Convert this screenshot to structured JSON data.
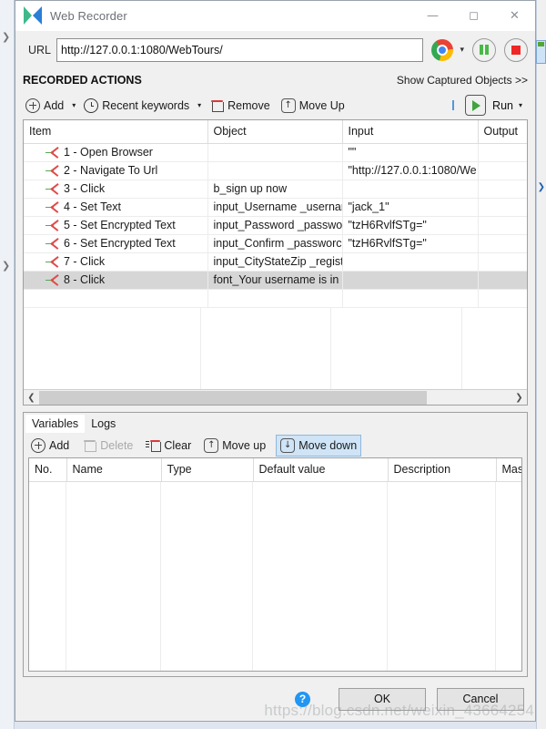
{
  "window": {
    "title": "Web Recorder",
    "logo_icon": "katalon-k-logo",
    "minimize_icon": "minimize-icon",
    "maximize_icon": "maximize-icon",
    "close_icon": "close-icon"
  },
  "url_bar": {
    "label": "URL",
    "value": "http://127.0.0.1:1080/WebTours/",
    "placeholder": "",
    "browser_icon": "chrome-icon",
    "browser_caret": "▾",
    "pause_icon": "pause-icon",
    "stop_icon": "stop-icon"
  },
  "section": {
    "title": "RECORDED ACTIONS",
    "show_captured": "Show Captured Objects >>"
  },
  "action_toolbar": {
    "add": "Add",
    "add_caret": "▾",
    "recent_keywords": "Recent keywords",
    "recent_caret": "▾",
    "remove": "Remove",
    "move_up": "Move Up",
    "move_up_glyph": "↑",
    "run": "Run",
    "run_caret": "▾"
  },
  "actions_table": {
    "columns": [
      "Item",
      "Object",
      "Input",
      "Output"
    ],
    "rows": [
      {
        "item": "1 - Open Browser",
        "object": "",
        "input": "\"\"",
        "output": ""
      },
      {
        "item": "2 - Navigate To Url",
        "object": "",
        "input": "\"http://127.0.0.1:1080/We",
        "output": ""
      },
      {
        "item": "3 - Click",
        "object": "b_sign up now",
        "input": "",
        "output": ""
      },
      {
        "item": "4 - Set Text",
        "object": "input_Username _usernar",
        "input": "\"jack_1\"",
        "output": ""
      },
      {
        "item": "5 - Set Encrypted Text",
        "object": "input_Password _passwo",
        "input": "\"tzH6RvlfSTg=\"",
        "output": ""
      },
      {
        "item": "6 - Set Encrypted Text",
        "object": "input_Confirm _passworc",
        "input": "\"tzH6RvlfSTg=\"",
        "output": ""
      },
      {
        "item": "7 - Click",
        "object": "input_CityStateZip _regist",
        "input": "",
        "output": ""
      },
      {
        "item": "8 - Click",
        "object": "font_Your username is in",
        "input": "",
        "output": "",
        "selected": true
      }
    ],
    "scroll_left_glyph": "❮",
    "scroll_right_glyph": "❯"
  },
  "variables_panel": {
    "tabs": [
      {
        "label": "Variables",
        "active": true
      },
      {
        "label": "Logs",
        "active": false
      }
    ],
    "toolbar": {
      "add": "Add",
      "delete": "Delete",
      "clear": "Clear",
      "move_up": "Move up",
      "move_up_glyph": "↑",
      "move_down": "Move down",
      "move_down_glyph": "↓"
    },
    "columns": [
      "No.",
      "Name",
      "Type",
      "Default value",
      "Description",
      "Mas..."
    ],
    "rows": []
  },
  "footer": {
    "help_glyph": "?",
    "ok": "OK",
    "cancel": "Cancel"
  },
  "watermark": "https://blog.csdn.net/weixin_43664254",
  "background": {
    "chevron_glyph": "❯"
  },
  "colors": {
    "accent_blue": "#2a7ed6",
    "accent_green": "#3fb98a",
    "run_green": "#41a43c",
    "stop_red": "#ef2626",
    "selection_gray": "#d6d6d6",
    "highlight_blue": "#cfe4f7"
  }
}
